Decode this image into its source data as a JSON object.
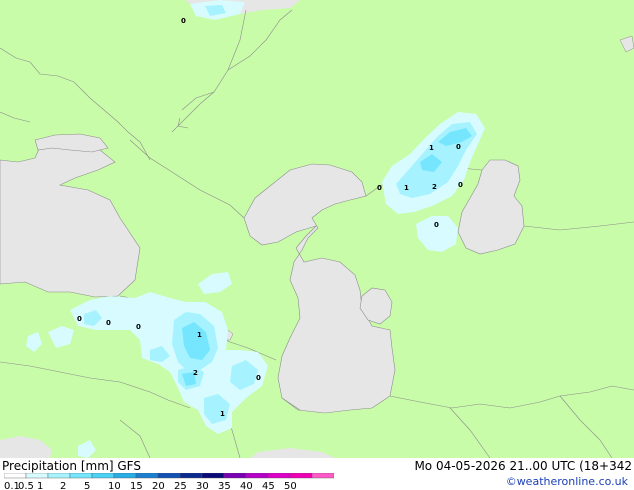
{
  "title": "Precipitation [mm]  GFS",
  "timestamp": "Mo 04-05-2026 21..00 UTC (18+342",
  "credit": "©weatheronline.co.uk",
  "colors": {
    "land": "#c8fca8",
    "sea": "#e6e6e6",
    "border": "#8c8c8c"
  },
  "legend": {
    "ticks": [
      "0.1",
      "0.5",
      "1",
      "2",
      "5",
      "10",
      "15",
      "20",
      "25",
      "30",
      "35",
      "40",
      "45",
      "50"
    ],
    "colors": [
      "#ffffff",
      "#d8fbff",
      "#a6f3ff",
      "#76e6ff",
      "#4bd2f5",
      "#28aee6",
      "#1b7fd0",
      "#1250b2",
      "#0a2a8c",
      "#0a0a78",
      "#7a00b4",
      "#b400c8",
      "#dc00c8",
      "#f000b4",
      "#ff5ac8"
    ]
  },
  "precip_labels": [
    {
      "text": "0",
      "name": "precip-label-north"
    },
    {
      "text": "1",
      "name": "precip-label-kazakh-1a"
    },
    {
      "text": "0",
      "name": "precip-label-kazakh-0a"
    },
    {
      "text": "0",
      "name": "precip-label-kazakh-0b"
    },
    {
      "text": "1",
      "name": "precip-label-kazakh-1b"
    },
    {
      "text": "2",
      "name": "precip-label-kazakh-2"
    },
    {
      "text": "0",
      "name": "precip-label-kazakh-0c"
    },
    {
      "text": "0",
      "name": "precip-label-kazakh-0d"
    },
    {
      "text": "0",
      "name": "precip-label-turkey-0a"
    },
    {
      "text": "0",
      "name": "precip-label-turkey-0b"
    },
    {
      "text": "0",
      "name": "precip-label-turkey-0c"
    },
    {
      "text": "1",
      "name": "precip-label-caucasus-1"
    },
    {
      "text": "2",
      "name": "precip-label-caucasus-2"
    },
    {
      "text": "0",
      "name": "precip-label-caucasus-0"
    },
    {
      "text": "1",
      "name": "precip-label-iran-1"
    }
  ]
}
